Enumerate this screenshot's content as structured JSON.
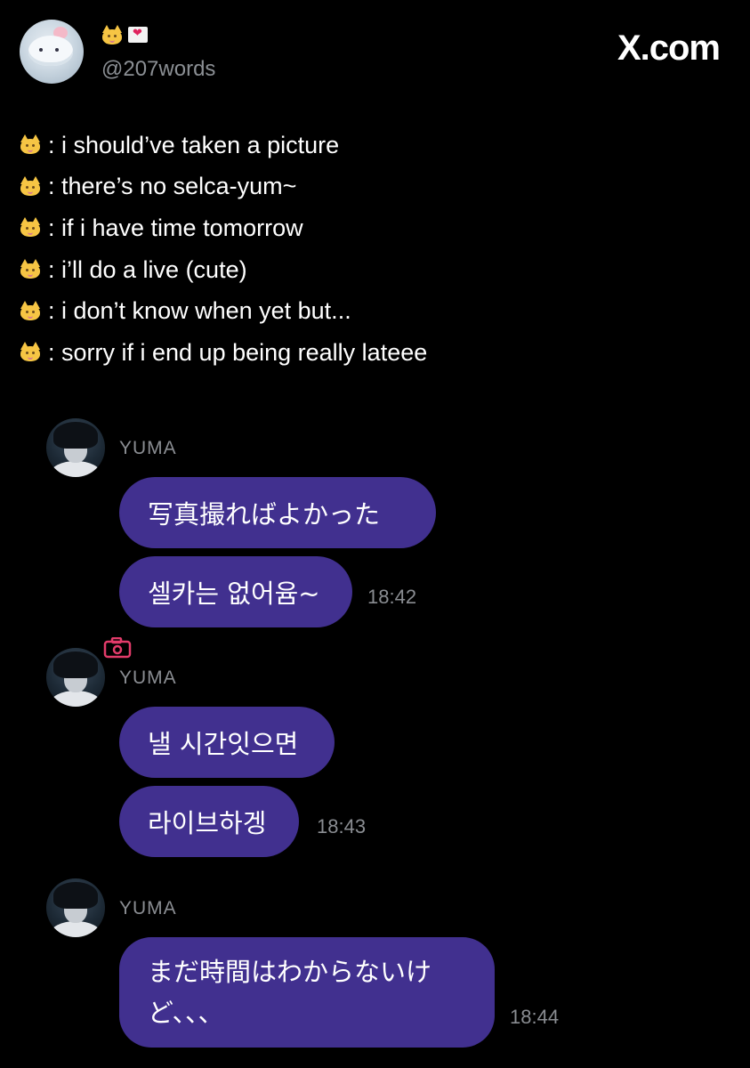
{
  "header": {
    "handle": "@207words",
    "site_logo": "X.com",
    "display_name_icons": [
      "cat-emoji",
      "heart-letter-emoji"
    ]
  },
  "tweet": {
    "lines": [
      {
        "icon": "cat-emoji",
        "text": ": i should’ve taken a picture"
      },
      {
        "icon": "cat-emoji",
        "text": ": there’s no selca-yum~"
      },
      {
        "icon": "cat-emoji",
        "text": ": if i have time tomorrow"
      },
      {
        "icon": "cat-emoji",
        "text": ": i’ll do a live (cute)"
      },
      {
        "icon": "cat-emoji",
        "text": ": i don’t know when yet but..."
      },
      {
        "icon": "cat-emoji",
        "text": ": sorry if i end up being really lateee"
      }
    ]
  },
  "chat": {
    "groups": [
      {
        "sender": "YUMA",
        "messages": [
          "写真撮ればよかった",
          "셀카는 없어윰~"
        ],
        "time": "18:42"
      },
      {
        "sender": "YUMA",
        "badge_icon": "camera-icon",
        "messages": [
          "낼 시간잇으면",
          "라이브하겡"
        ],
        "time": "18:43"
      },
      {
        "sender": "YUMA",
        "messages": [
          "まだ時間はわからないけど、、、"
        ],
        "message_lines": [
          "まだ時間はわからないけ",
          "ど、、、"
        ],
        "time": "18:44"
      }
    ]
  },
  "colors": {
    "background": "#000000",
    "bubble": "#41308f",
    "muted_text": "#8a8d92",
    "cat_emoji": "#f6c544",
    "camera_icon": "#e23b6a"
  }
}
